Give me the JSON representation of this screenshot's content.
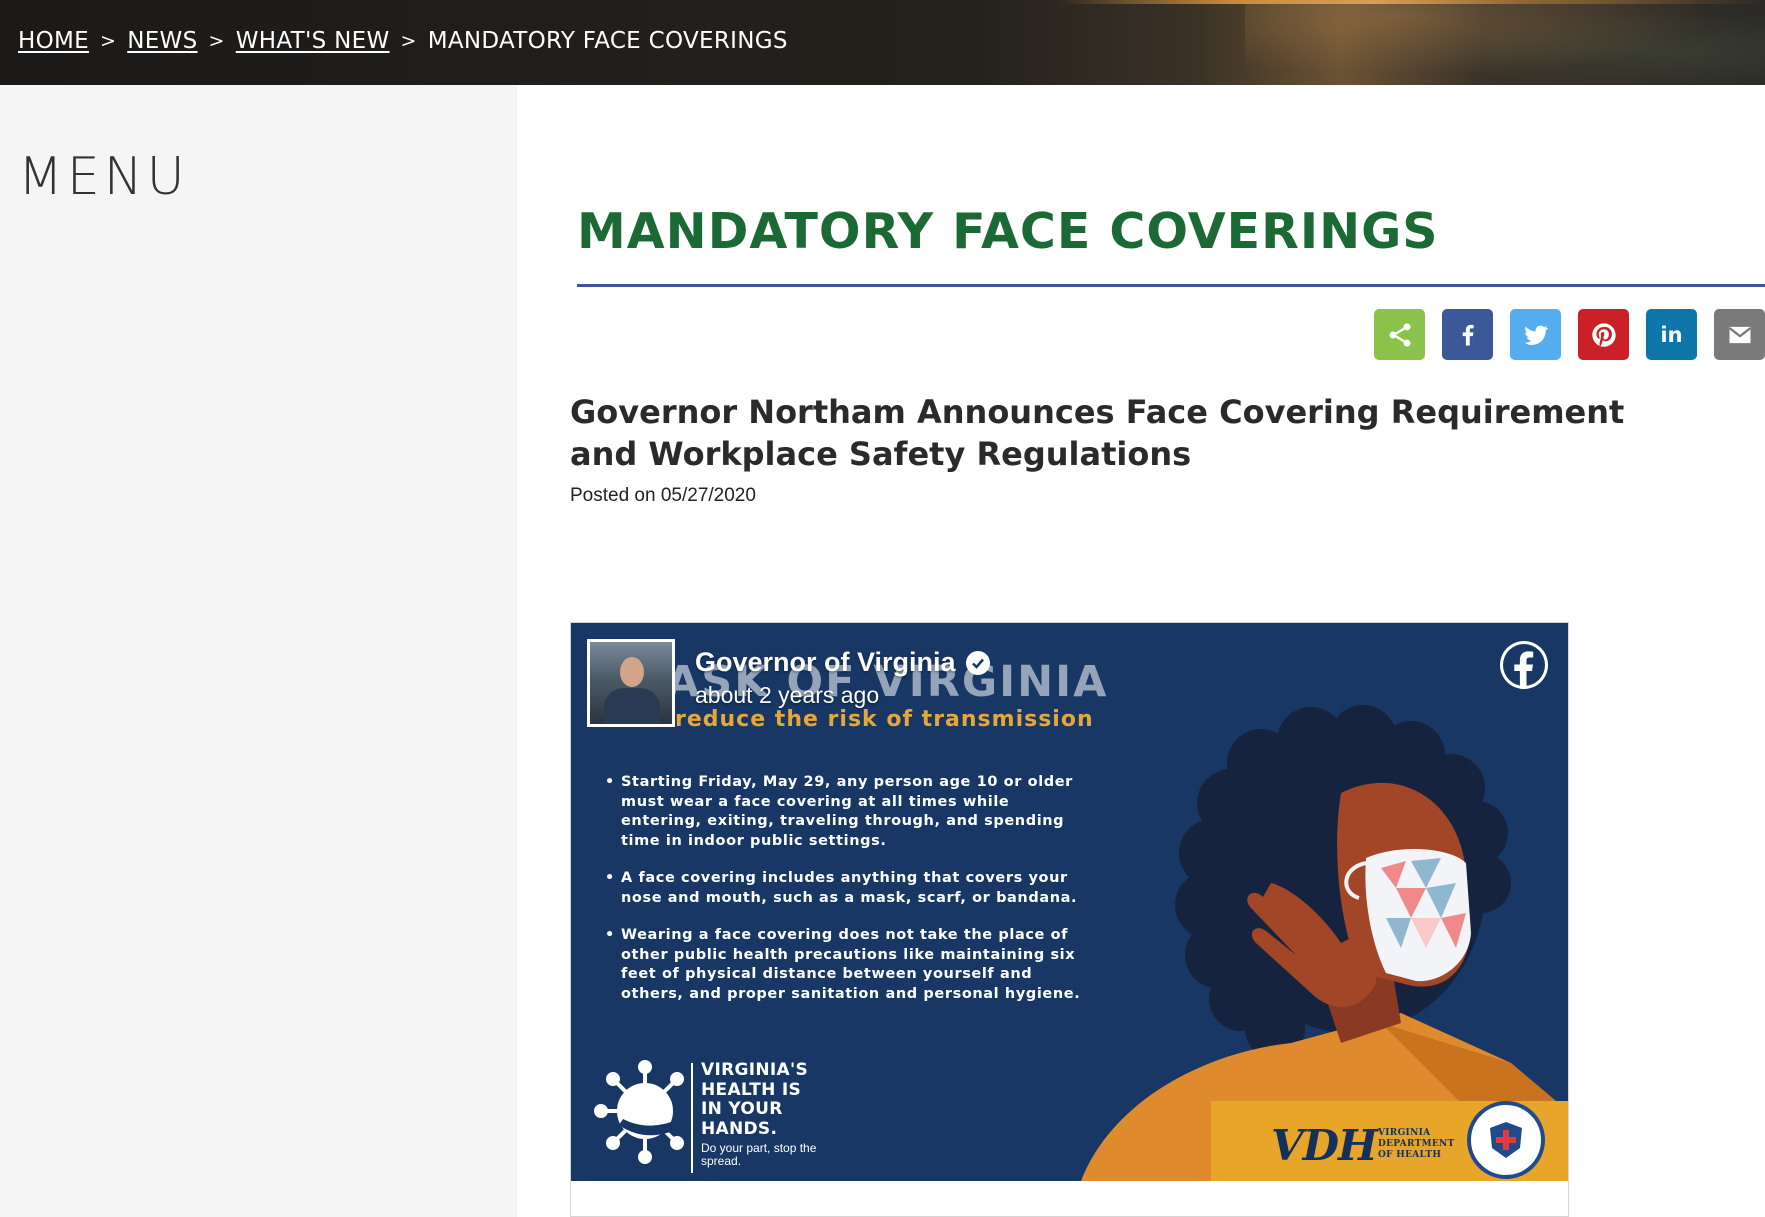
{
  "breadcrumb": {
    "home": "HOME",
    "news": "NEWS",
    "whats_new": "WHAT'S NEW",
    "current": "MANDATORY FACE COVERINGS",
    "separator": ">"
  },
  "sidebar": {
    "menu_label": "MENU"
  },
  "page": {
    "title": "MANDATORY FACE COVERINGS",
    "title_color": "#1b6a36",
    "rule_color": "#3f53a0"
  },
  "share": {
    "buttons": [
      {
        "name": "share",
        "icon": "share-icon",
        "color": "#8bc34a"
      },
      {
        "name": "facebook",
        "icon": "facebook-icon",
        "color": "#3b5998"
      },
      {
        "name": "twitter",
        "icon": "twitter-icon",
        "color": "#55acee"
      },
      {
        "name": "pinterest",
        "icon": "pinterest-icon",
        "color": "#cb2027"
      },
      {
        "name": "linkedin",
        "icon": "linkedin-icon",
        "color": "#0e76a8",
        "label": "in"
      },
      {
        "name": "email",
        "icon": "email-icon",
        "color": "#7a7a7a"
      }
    ]
  },
  "article": {
    "title": "Governor Northam Announces Face Covering Requirement and Workplace Safety Regulations",
    "posted": "Posted on 05/27/2020"
  },
  "facebook_embed": {
    "page_name": "Governor of Virginia",
    "time": "about 2 years ago",
    "graphic": {
      "headline": "ASK OF VIRGINIA",
      "subhead": "reduce the risk of transmission",
      "bullets": [
        "Starting Friday, May 29, any person age 10 or older must wear a face covering at all times while entering, exiting, traveling through, and spending time in indoor public settings.",
        "A face covering includes anything that covers your nose and mouth, such as a mask, scarf, or bandana.",
        "Wearing a face covering does not take the place of other public health precautions like maintaining six feet of physical distance between yourself and others, and proper sanitation and personal hygiene."
      ],
      "campaign_title": "VIRGINIA'S HEALTH IS IN YOUR HANDS.",
      "campaign_sub": "Do your part, stop the spread.",
      "vdh_letters": "VDH",
      "vdh_name": "VIRGINIA DEPARTMENT OF HEALTH"
    }
  }
}
